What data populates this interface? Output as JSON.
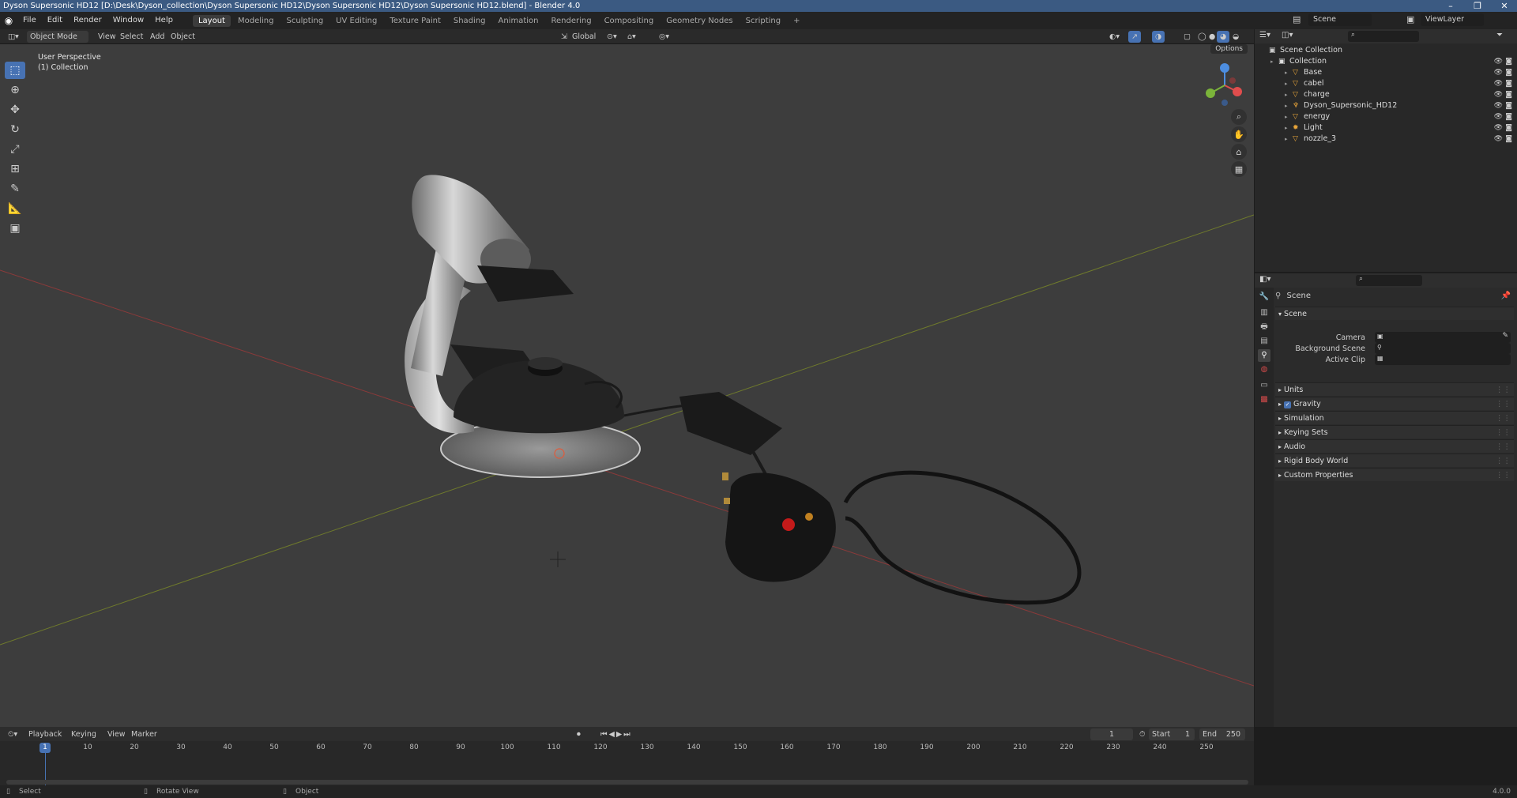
{
  "window": {
    "title": "Dyson Supersonic HD12 [D:\\Desk\\Dyson_collection\\Dyson Supersonic HD12\\Dyson Supersonic HD12\\Dyson Supersonic HD12.blend] - Blender 4.0"
  },
  "menus": [
    "File",
    "Edit",
    "Render",
    "Window",
    "Help"
  ],
  "workspaces": [
    "Layout",
    "Modeling",
    "Sculpting",
    "UV Editing",
    "Texture Paint",
    "Shading",
    "Animation",
    "Rendering",
    "Compositing",
    "Geometry Nodes",
    "Scripting"
  ],
  "active_workspace": "Layout",
  "add_workspace": "+",
  "scene_name": "Scene",
  "viewlayer_name": "ViewLayer",
  "viewport": {
    "mode": "Object Mode",
    "menu": [
      "View",
      "Select",
      "Add",
      "Object"
    ],
    "orientation": "Global",
    "options_label": "Options",
    "overlay_line1": "User Perspective",
    "overlay_line2": "(1) Collection",
    "gizmo": {
      "x": "X",
      "y": "Y",
      "z": "Z"
    }
  },
  "outliner": {
    "root": "Scene Collection",
    "collection": "Collection",
    "items": [
      {
        "name": "Base",
        "type": "mesh"
      },
      {
        "name": "cabel",
        "type": "mesh"
      },
      {
        "name": "charge",
        "type": "mesh"
      },
      {
        "name": "Dyson_Supersonic_HD12",
        "type": "armature"
      },
      {
        "name": "energy",
        "type": "mesh"
      },
      {
        "name": "Light",
        "type": "light"
      },
      {
        "name": "nozzle_3",
        "type": "mesh"
      }
    ]
  },
  "properties": {
    "context": "Scene",
    "panel": "Scene",
    "fields": [
      {
        "label": "Camera"
      },
      {
        "label": "Background Scene"
      },
      {
        "label": "Active Clip"
      }
    ],
    "sections": [
      "Units",
      "Gravity",
      "Simulation",
      "Keying Sets",
      "Audio",
      "Rigid Body World",
      "Custom Properties"
    ],
    "gravity_checked": true
  },
  "timeline": {
    "menu": [
      "Playback",
      "Keying",
      "View",
      "Marker"
    ],
    "current_frame": "1",
    "start_label": "Start",
    "start_value": "1",
    "end_label": "End",
    "end_value": "250",
    "ticks": [
      "10",
      "20",
      "30",
      "40",
      "50",
      "60",
      "70",
      "80",
      "90",
      "100",
      "110",
      "120",
      "130",
      "140",
      "150",
      "160",
      "170",
      "180",
      "190",
      "200",
      "210",
      "220",
      "230",
      "240",
      "250"
    ],
    "playhead": "1"
  },
  "status": {
    "select": "Select",
    "rotate": "Rotate View",
    "object": "Object",
    "version": "4.0.0"
  }
}
